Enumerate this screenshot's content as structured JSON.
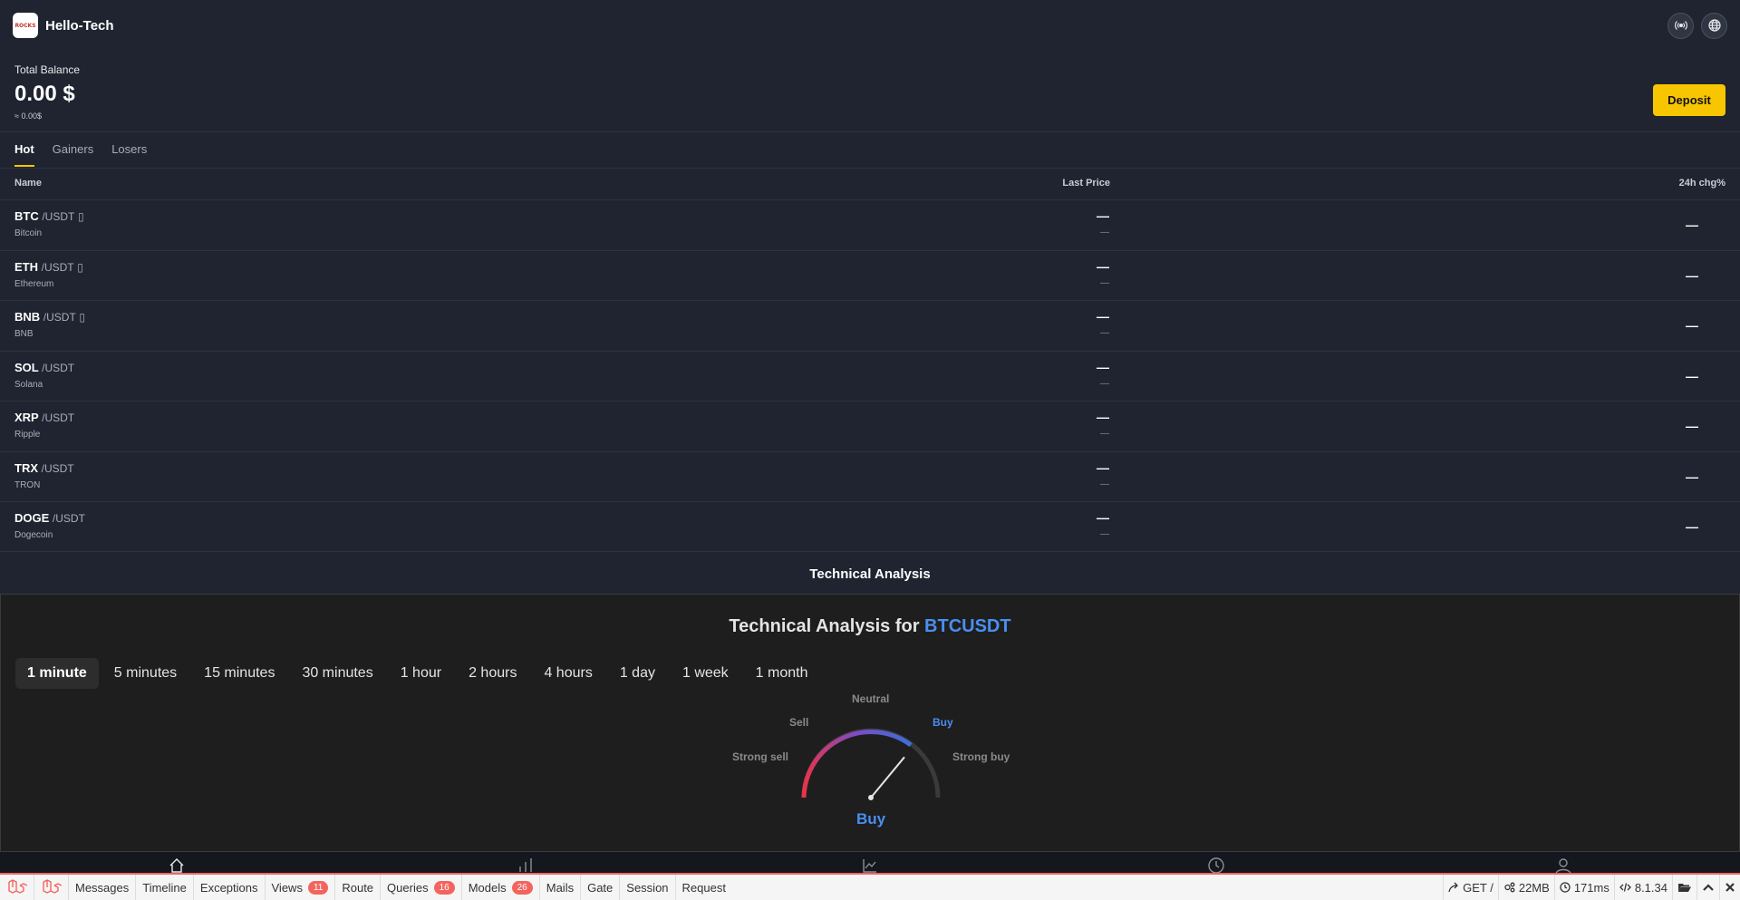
{
  "header": {
    "logo_text": "ROCKS",
    "brand": "Hello-Tech",
    "icons": [
      "broadcast-icon",
      "globe-icon"
    ]
  },
  "balance": {
    "label": "Total Balance",
    "amount": "0.00 $",
    "approx": "≈ 0.00$",
    "deposit_label": "Deposit"
  },
  "tabs": [
    {
      "label": "Hot",
      "active": true
    },
    {
      "label": "Gainers"
    },
    {
      "label": "Losers"
    }
  ],
  "table": {
    "headers": {
      "name": "Name",
      "last_price": "Last Price",
      "change": "24h chg%"
    },
    "rows": [
      {
        "symbol": "BTC",
        "pair": "/USDT",
        "flag": "▯",
        "name": "Bitcoin",
        "price": "—",
        "price_sub": "—",
        "change": "—"
      },
      {
        "symbol": "ETH",
        "pair": "/USDT",
        "flag": "▯",
        "name": "Ethereum",
        "price": "—",
        "price_sub": "—",
        "change": "—"
      },
      {
        "symbol": "BNB",
        "pair": "/USDT",
        "flag": "▯",
        "name": "BNB",
        "price": "—",
        "price_sub": "—",
        "change": "—"
      },
      {
        "symbol": "SOL",
        "pair": "/USDT",
        "flag": "",
        "name": "Solana",
        "price": "—",
        "price_sub": "—",
        "change": "—"
      },
      {
        "symbol": "XRP",
        "pair": "/USDT",
        "flag": "",
        "name": "Ripple",
        "price": "—",
        "price_sub": "—",
        "change": "—"
      },
      {
        "symbol": "TRX",
        "pair": "/USDT",
        "flag": "",
        "name": "TRON",
        "price": "—",
        "price_sub": "—",
        "change": "—"
      },
      {
        "symbol": "DOGE",
        "pair": "/USDT",
        "flag": "",
        "name": "Dogecoin",
        "price": "—",
        "price_sub": "—",
        "change": "—"
      }
    ]
  },
  "technical": {
    "section_heading": "Technical Analysis",
    "title_prefix": "Technical Analysis for",
    "symbol": "BTCUSDT",
    "intervals": [
      {
        "label": "1 minute",
        "active": true
      },
      {
        "label": "5 minutes"
      },
      {
        "label": "15 minutes"
      },
      {
        "label": "30 minutes"
      },
      {
        "label": "1 hour"
      },
      {
        "label": "2 hours"
      },
      {
        "label": "4 hours"
      },
      {
        "label": "1 day"
      },
      {
        "label": "1 week"
      },
      {
        "label": "1 month"
      }
    ],
    "gauge": {
      "labels": {
        "strong_sell": "Strong sell",
        "sell": "Sell",
        "neutral": "Neutral",
        "buy": "Buy",
        "strong_buy": "Strong buy"
      },
      "result": "Buy",
      "needle_value": 0.72,
      "colors": {
        "sell": "#e8334a",
        "neutral": "#7b4cc8",
        "buy": "#3b6fd8",
        "highlight": "#4a8ef0"
      }
    }
  },
  "bottom_nav": {
    "icons": [
      "home-icon",
      "markets-icon",
      "trade-icon",
      "history-icon",
      "profile-icon"
    ]
  },
  "debugbar": {
    "items": [
      {
        "label": "Messages"
      },
      {
        "label": "Timeline"
      },
      {
        "label": "Exceptions"
      },
      {
        "label": "Views",
        "badge": "11"
      },
      {
        "label": "Route"
      },
      {
        "label": "Queries",
        "badge": "16"
      },
      {
        "label": "Models",
        "badge": "26"
      },
      {
        "label": "Mails"
      },
      {
        "label": "Gate"
      },
      {
        "label": "Session"
      },
      {
        "label": "Request"
      }
    ],
    "right": {
      "request": "GET /",
      "memory": "22MB",
      "time": "171ms",
      "php": "8.1.34"
    }
  }
}
